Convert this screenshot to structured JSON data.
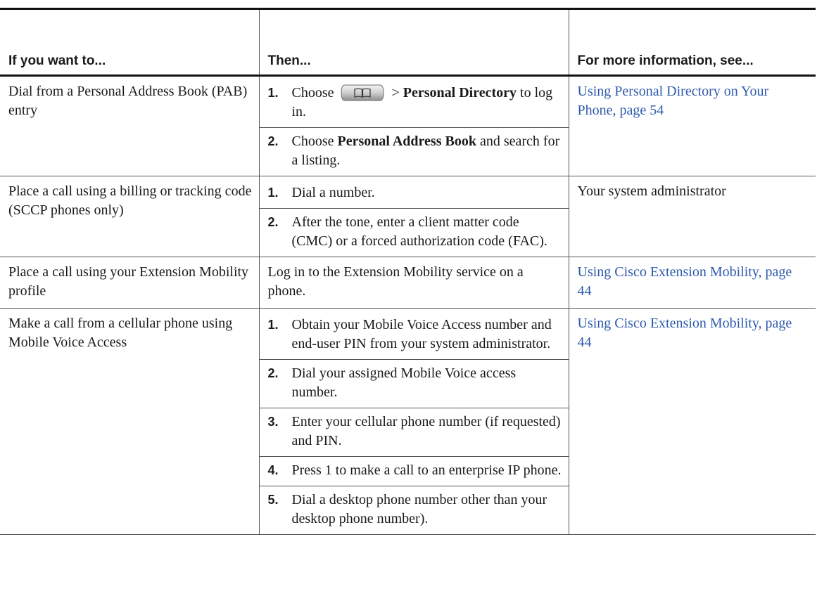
{
  "header": {
    "col1": "If you want to...",
    "col2": "Then...",
    "col3": "For more information, see..."
  },
  "rows": [
    {
      "task": "Dial from a Personal Address Book (PAB) entry",
      "steps": [
        {
          "num": "1.",
          "pre": "Choose",
          "icon": "directories-button-icon",
          "mid": " > ",
          "bold": "Personal Directory",
          "post": " to log in."
        },
        {
          "num": "2.",
          "pre": "Choose ",
          "bold": "Personal Address Book",
          "post": " and search for a listing."
        }
      ],
      "info": "Using Personal Directory on Your Phone, page 54",
      "info_is_link": true
    },
    {
      "task": "Place a call using a billing or tracking code (SCCP phones only)",
      "steps": [
        {
          "num": "1.",
          "text": "Dial a number."
        },
        {
          "num": "2.",
          "text": "After the tone, enter a client matter code (CMC) or a forced authorization code (FAC)."
        }
      ],
      "info": "Your system administrator",
      "info_is_link": false
    },
    {
      "task": "Place a call using your Extension Mobility profile",
      "plain": "Log in to the Extension Mobility service on a phone.",
      "info": "Using Cisco Extension Mobility, page 44",
      "info_is_link": true
    },
    {
      "task": "Make a call from a cellular phone using Mobile Voice Access",
      "steps": [
        {
          "num": "1.",
          "text": "Obtain your Mobile Voice Access number and end-user PIN from your system administrator."
        },
        {
          "num": "2.",
          "text": "Dial your assigned Mobile Voice access number."
        },
        {
          "num": "3.",
          "text": "Enter your cellular phone number (if requested) and PIN."
        },
        {
          "num": "4.",
          "text": "Press 1 to make a call to an enterprise IP phone."
        },
        {
          "num": "5.",
          "text": "Dial a desktop phone number other than your desktop phone number)."
        }
      ],
      "info": "Using Cisco Extension Mobility, page 44",
      "info_is_link": true
    }
  ],
  "colors": {
    "link": "#2e5aab",
    "text": "#1a1a1a",
    "rule": "#555555"
  }
}
